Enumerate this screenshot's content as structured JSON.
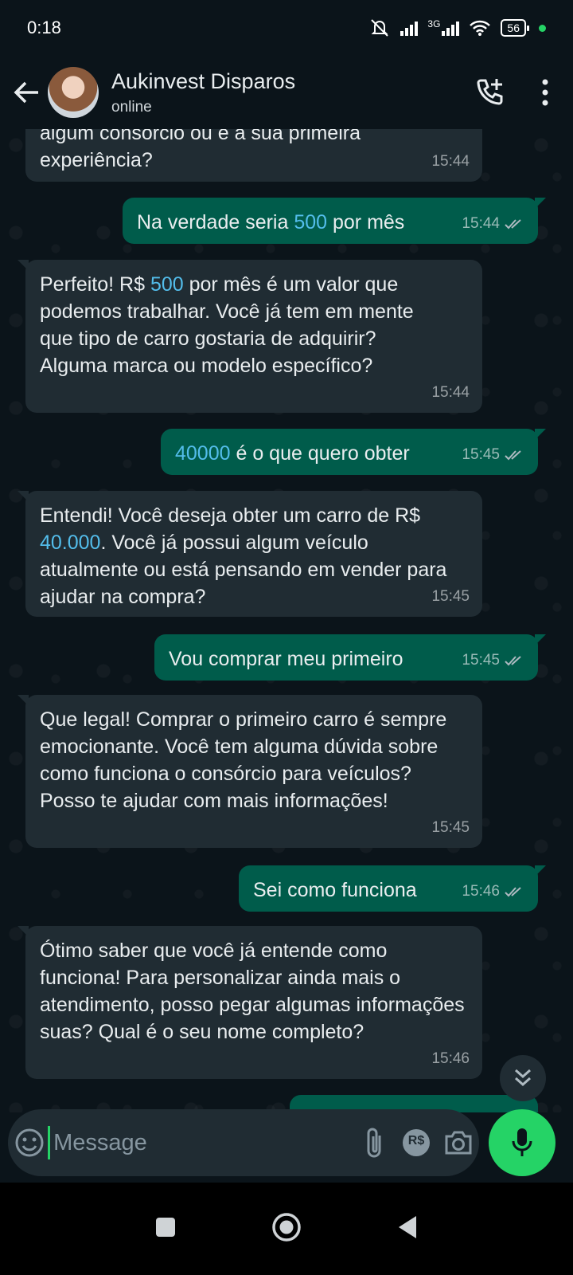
{
  "status_bar": {
    "time": "0:18",
    "network": "3G",
    "battery": "56"
  },
  "header": {
    "contact_name": "Aukinvest Disparos",
    "contact_status": "online"
  },
  "messages": [
    {
      "dir": "in",
      "text_a": "algum consórcio ou é a sua primeira",
      "text_b": "experiência?",
      "time": "15:44"
    },
    {
      "dir": "out",
      "pre": "Na verdade seria ",
      "num": "500",
      "post": " por mês",
      "time": "15:44"
    },
    {
      "dir": "in",
      "pre": "Perfeito! R$ ",
      "num": "500",
      "post": " por mês é um valor que podemos trabalhar. Você já tem em mente que tipo de carro gostaria de adquirir? Alguma marca ou modelo específico?",
      "time": "15:44"
    },
    {
      "dir": "out",
      "pre": "",
      "num": "40000",
      "post": " é o que quero obter",
      "time": "15:45"
    },
    {
      "dir": "in",
      "pre": "Entendi! Você deseja obter um carro de R$ ",
      "num": "40.000",
      "post": ". Você já possui algum veículo atualmente ou está pensando em vender para ajudar na compra?",
      "time": "15:45"
    },
    {
      "dir": "out",
      "text": "Vou comprar meu primeiro",
      "time": "15:45"
    },
    {
      "dir": "in",
      "text": "Que legal! Comprar o primeiro carro é sempre emocionante. Você tem alguma dúvida sobre como funciona o consórcio para veículos? Posso te ajudar com mais informações!",
      "time": "15:45"
    },
    {
      "dir": "out",
      "text": "Sei como funciona",
      "time": "15:46"
    },
    {
      "dir": "in",
      "text": "Ótimo saber que você já entende como funciona! Para personalizar ainda mais o atendimento, posso pegar algumas informações suas? Qual é o seu nome completo?",
      "time": "15:46"
    }
  ],
  "input": {
    "placeholder": "Message",
    "pay_label": "R$"
  },
  "icons": {
    "back": "arrow-left-icon",
    "call": "add-call-icon",
    "menu": "more-vertical-icon",
    "emoji": "emoji-icon",
    "attach": "paperclip-icon",
    "payment": "rs-payment-icon",
    "camera": "camera-icon",
    "mic": "microphone-icon",
    "scroll": "double-chevron-down-icon"
  },
  "colors": {
    "accent": "#25d366",
    "outgoing": "#005c4b",
    "incoming": "#202c33",
    "link_number": "#53bdeb"
  }
}
